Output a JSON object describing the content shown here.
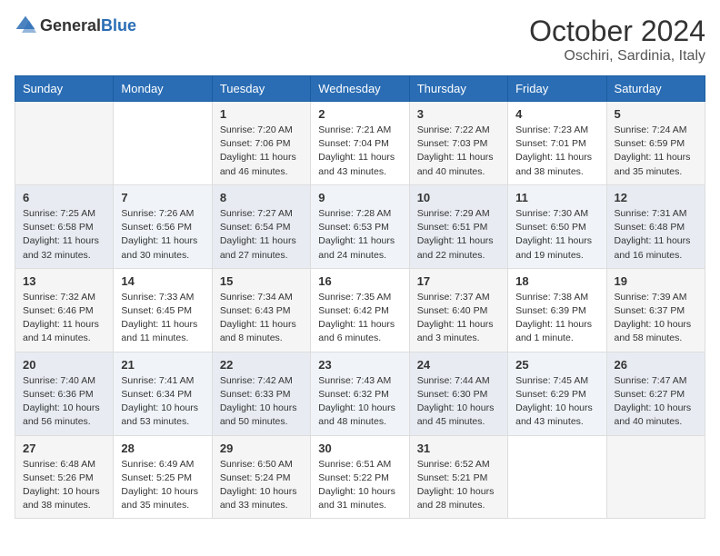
{
  "header": {
    "logo_general": "General",
    "logo_blue": "Blue",
    "month_title": "October 2024",
    "location": "Oschiri, Sardinia, Italy"
  },
  "weekdays": [
    "Sunday",
    "Monday",
    "Tuesday",
    "Wednesday",
    "Thursday",
    "Friday",
    "Saturday"
  ],
  "weeks": [
    [
      {
        "day": "",
        "sunrise": "",
        "sunset": "",
        "daylight": ""
      },
      {
        "day": "",
        "sunrise": "",
        "sunset": "",
        "daylight": ""
      },
      {
        "day": "1",
        "sunrise": "Sunrise: 7:20 AM",
        "sunset": "Sunset: 7:06 PM",
        "daylight": "Daylight: 11 hours and 46 minutes."
      },
      {
        "day": "2",
        "sunrise": "Sunrise: 7:21 AM",
        "sunset": "Sunset: 7:04 PM",
        "daylight": "Daylight: 11 hours and 43 minutes."
      },
      {
        "day": "3",
        "sunrise": "Sunrise: 7:22 AM",
        "sunset": "Sunset: 7:03 PM",
        "daylight": "Daylight: 11 hours and 40 minutes."
      },
      {
        "day": "4",
        "sunrise": "Sunrise: 7:23 AM",
        "sunset": "Sunset: 7:01 PM",
        "daylight": "Daylight: 11 hours and 38 minutes."
      },
      {
        "day": "5",
        "sunrise": "Sunrise: 7:24 AM",
        "sunset": "Sunset: 6:59 PM",
        "daylight": "Daylight: 11 hours and 35 minutes."
      }
    ],
    [
      {
        "day": "6",
        "sunrise": "Sunrise: 7:25 AM",
        "sunset": "Sunset: 6:58 PM",
        "daylight": "Daylight: 11 hours and 32 minutes."
      },
      {
        "day": "7",
        "sunrise": "Sunrise: 7:26 AM",
        "sunset": "Sunset: 6:56 PM",
        "daylight": "Daylight: 11 hours and 30 minutes."
      },
      {
        "day": "8",
        "sunrise": "Sunrise: 7:27 AM",
        "sunset": "Sunset: 6:54 PM",
        "daylight": "Daylight: 11 hours and 27 minutes."
      },
      {
        "day": "9",
        "sunrise": "Sunrise: 7:28 AM",
        "sunset": "Sunset: 6:53 PM",
        "daylight": "Daylight: 11 hours and 24 minutes."
      },
      {
        "day": "10",
        "sunrise": "Sunrise: 7:29 AM",
        "sunset": "Sunset: 6:51 PM",
        "daylight": "Daylight: 11 hours and 22 minutes."
      },
      {
        "day": "11",
        "sunrise": "Sunrise: 7:30 AM",
        "sunset": "Sunset: 6:50 PM",
        "daylight": "Daylight: 11 hours and 19 minutes."
      },
      {
        "day": "12",
        "sunrise": "Sunrise: 7:31 AM",
        "sunset": "Sunset: 6:48 PM",
        "daylight": "Daylight: 11 hours and 16 minutes."
      }
    ],
    [
      {
        "day": "13",
        "sunrise": "Sunrise: 7:32 AM",
        "sunset": "Sunset: 6:46 PM",
        "daylight": "Daylight: 11 hours and 14 minutes."
      },
      {
        "day": "14",
        "sunrise": "Sunrise: 7:33 AM",
        "sunset": "Sunset: 6:45 PM",
        "daylight": "Daylight: 11 hours and 11 minutes."
      },
      {
        "day": "15",
        "sunrise": "Sunrise: 7:34 AM",
        "sunset": "Sunset: 6:43 PM",
        "daylight": "Daylight: 11 hours and 8 minutes."
      },
      {
        "day": "16",
        "sunrise": "Sunrise: 7:35 AM",
        "sunset": "Sunset: 6:42 PM",
        "daylight": "Daylight: 11 hours and 6 minutes."
      },
      {
        "day": "17",
        "sunrise": "Sunrise: 7:37 AM",
        "sunset": "Sunset: 6:40 PM",
        "daylight": "Daylight: 11 hours and 3 minutes."
      },
      {
        "day": "18",
        "sunrise": "Sunrise: 7:38 AM",
        "sunset": "Sunset: 6:39 PM",
        "daylight": "Daylight: 11 hours and 1 minute."
      },
      {
        "day": "19",
        "sunrise": "Sunrise: 7:39 AM",
        "sunset": "Sunset: 6:37 PM",
        "daylight": "Daylight: 10 hours and 58 minutes."
      }
    ],
    [
      {
        "day": "20",
        "sunrise": "Sunrise: 7:40 AM",
        "sunset": "Sunset: 6:36 PM",
        "daylight": "Daylight: 10 hours and 56 minutes."
      },
      {
        "day": "21",
        "sunrise": "Sunrise: 7:41 AM",
        "sunset": "Sunset: 6:34 PM",
        "daylight": "Daylight: 10 hours and 53 minutes."
      },
      {
        "day": "22",
        "sunrise": "Sunrise: 7:42 AM",
        "sunset": "Sunset: 6:33 PM",
        "daylight": "Daylight: 10 hours and 50 minutes."
      },
      {
        "day": "23",
        "sunrise": "Sunrise: 7:43 AM",
        "sunset": "Sunset: 6:32 PM",
        "daylight": "Daylight: 10 hours and 48 minutes."
      },
      {
        "day": "24",
        "sunrise": "Sunrise: 7:44 AM",
        "sunset": "Sunset: 6:30 PM",
        "daylight": "Daylight: 10 hours and 45 minutes."
      },
      {
        "day": "25",
        "sunrise": "Sunrise: 7:45 AM",
        "sunset": "Sunset: 6:29 PM",
        "daylight": "Daylight: 10 hours and 43 minutes."
      },
      {
        "day": "26",
        "sunrise": "Sunrise: 7:47 AM",
        "sunset": "Sunset: 6:27 PM",
        "daylight": "Daylight: 10 hours and 40 minutes."
      }
    ],
    [
      {
        "day": "27",
        "sunrise": "Sunrise: 6:48 AM",
        "sunset": "Sunset: 5:26 PM",
        "daylight": "Daylight: 10 hours and 38 minutes."
      },
      {
        "day": "28",
        "sunrise": "Sunrise: 6:49 AM",
        "sunset": "Sunset: 5:25 PM",
        "daylight": "Daylight: 10 hours and 35 minutes."
      },
      {
        "day": "29",
        "sunrise": "Sunrise: 6:50 AM",
        "sunset": "Sunset: 5:24 PM",
        "daylight": "Daylight: 10 hours and 33 minutes."
      },
      {
        "day": "30",
        "sunrise": "Sunrise: 6:51 AM",
        "sunset": "Sunset: 5:22 PM",
        "daylight": "Daylight: 10 hours and 31 minutes."
      },
      {
        "day": "31",
        "sunrise": "Sunrise: 6:52 AM",
        "sunset": "Sunset: 5:21 PM",
        "daylight": "Daylight: 10 hours and 28 minutes."
      },
      {
        "day": "",
        "sunrise": "",
        "sunset": "",
        "daylight": ""
      },
      {
        "day": "",
        "sunrise": "",
        "sunset": "",
        "daylight": ""
      }
    ]
  ]
}
